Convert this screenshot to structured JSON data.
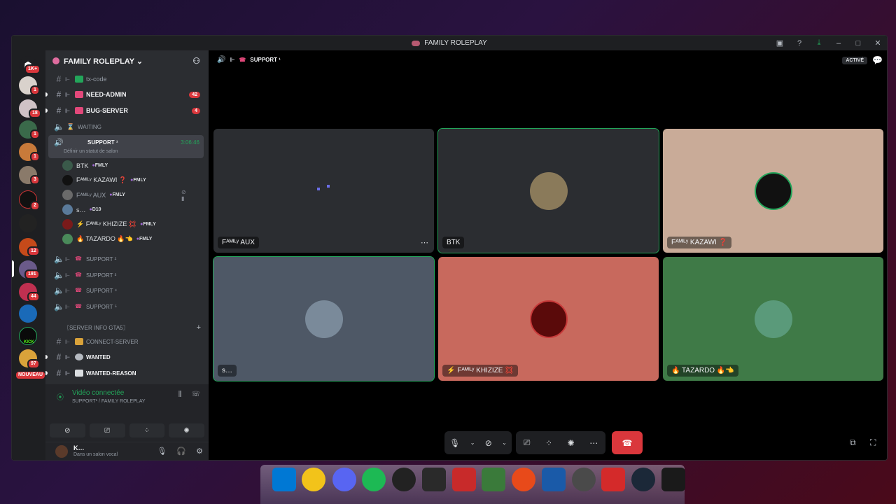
{
  "window": {
    "title": "FAMILY ROLEPLAY"
  },
  "guild": {
    "name": "FAMILY ROLEPLAY ⌄"
  },
  "rail": {
    "badges": [
      "1K+",
      "1",
      "18",
      "1",
      "1",
      "3",
      "2",
      "12",
      "191",
      "44",
      "97",
      "NOUVEAU"
    ],
    "labels": [
      "KICK"
    ]
  },
  "channels": {
    "tx_code": "tx-code",
    "need_admin": "NEED-ADMIN",
    "need_admin_count": "42",
    "bug_server": "BUG-SERVER",
    "bug_server_count": "4",
    "waiting": "WAITING",
    "support1": "SUPPORT ¹",
    "support1_time": "3:06:46",
    "support1_status": "Définir un statut de salon",
    "support2": "SUPPORT ²",
    "support3": "SUPPORT ³",
    "support4": "SUPPORT ⁴",
    "support5": "SUPPORT ⁵",
    "category": "〖SERVER INFO GTA5〗",
    "connect_server": "CONNECT-SERVER",
    "wanted": "WANTED",
    "wanted_reason": "WANTED-REASON"
  },
  "members": [
    {
      "name": "BTK",
      "tag": "FMLY"
    },
    {
      "name": "Fᴬᴹᴵᴸʸ KAZAWI ❓",
      "tag": "FMLY"
    },
    {
      "name": "Fᴬᴹᴵᴸʸ AUX",
      "tag": "FMLY"
    },
    {
      "name": "s…",
      "tag": "D10"
    },
    {
      "name": "⚡ Fᴬᴹᴵᴸʸ KHIZIZE 💢",
      "tag": "FMLY"
    },
    {
      "name": "🔥 TAZARDO 🔥👈",
      "tag": "FMLY"
    }
  ],
  "voice": {
    "status": "Vidéo connectée",
    "location": "SUPPORT¹ / FAMILY ROLEPLAY"
  },
  "user": {
    "name": "K…",
    "status": "Dans un salon vocal"
  },
  "call": {
    "channel": "SUPPORT ¹",
    "active_label": "ACTIVÉ"
  },
  "tiles": [
    {
      "name": "Fᴬᴹᴵᴸʸ AUX",
      "bg": "#2b2d31"
    },
    {
      "name": "BTK",
      "bg": "#2b2d31"
    },
    {
      "name": "Fᴬᴹᴵᴸʸ KAZAWI ❓",
      "bg": "#c9ab98"
    },
    {
      "name": "s…",
      "bg": "#4e5866"
    },
    {
      "name": "⚡ Fᴬᴹᴵᴸʸ KHIZIZE 💢",
      "bg": "#c8695d"
    },
    {
      "name": "🔥 TAZARDO 🔥👈",
      "bg": "#3f7a47"
    }
  ],
  "colors": {
    "accent_green": "#23a55a",
    "danger_red": "#da373c",
    "fmly_purple": "#a26ad6"
  }
}
